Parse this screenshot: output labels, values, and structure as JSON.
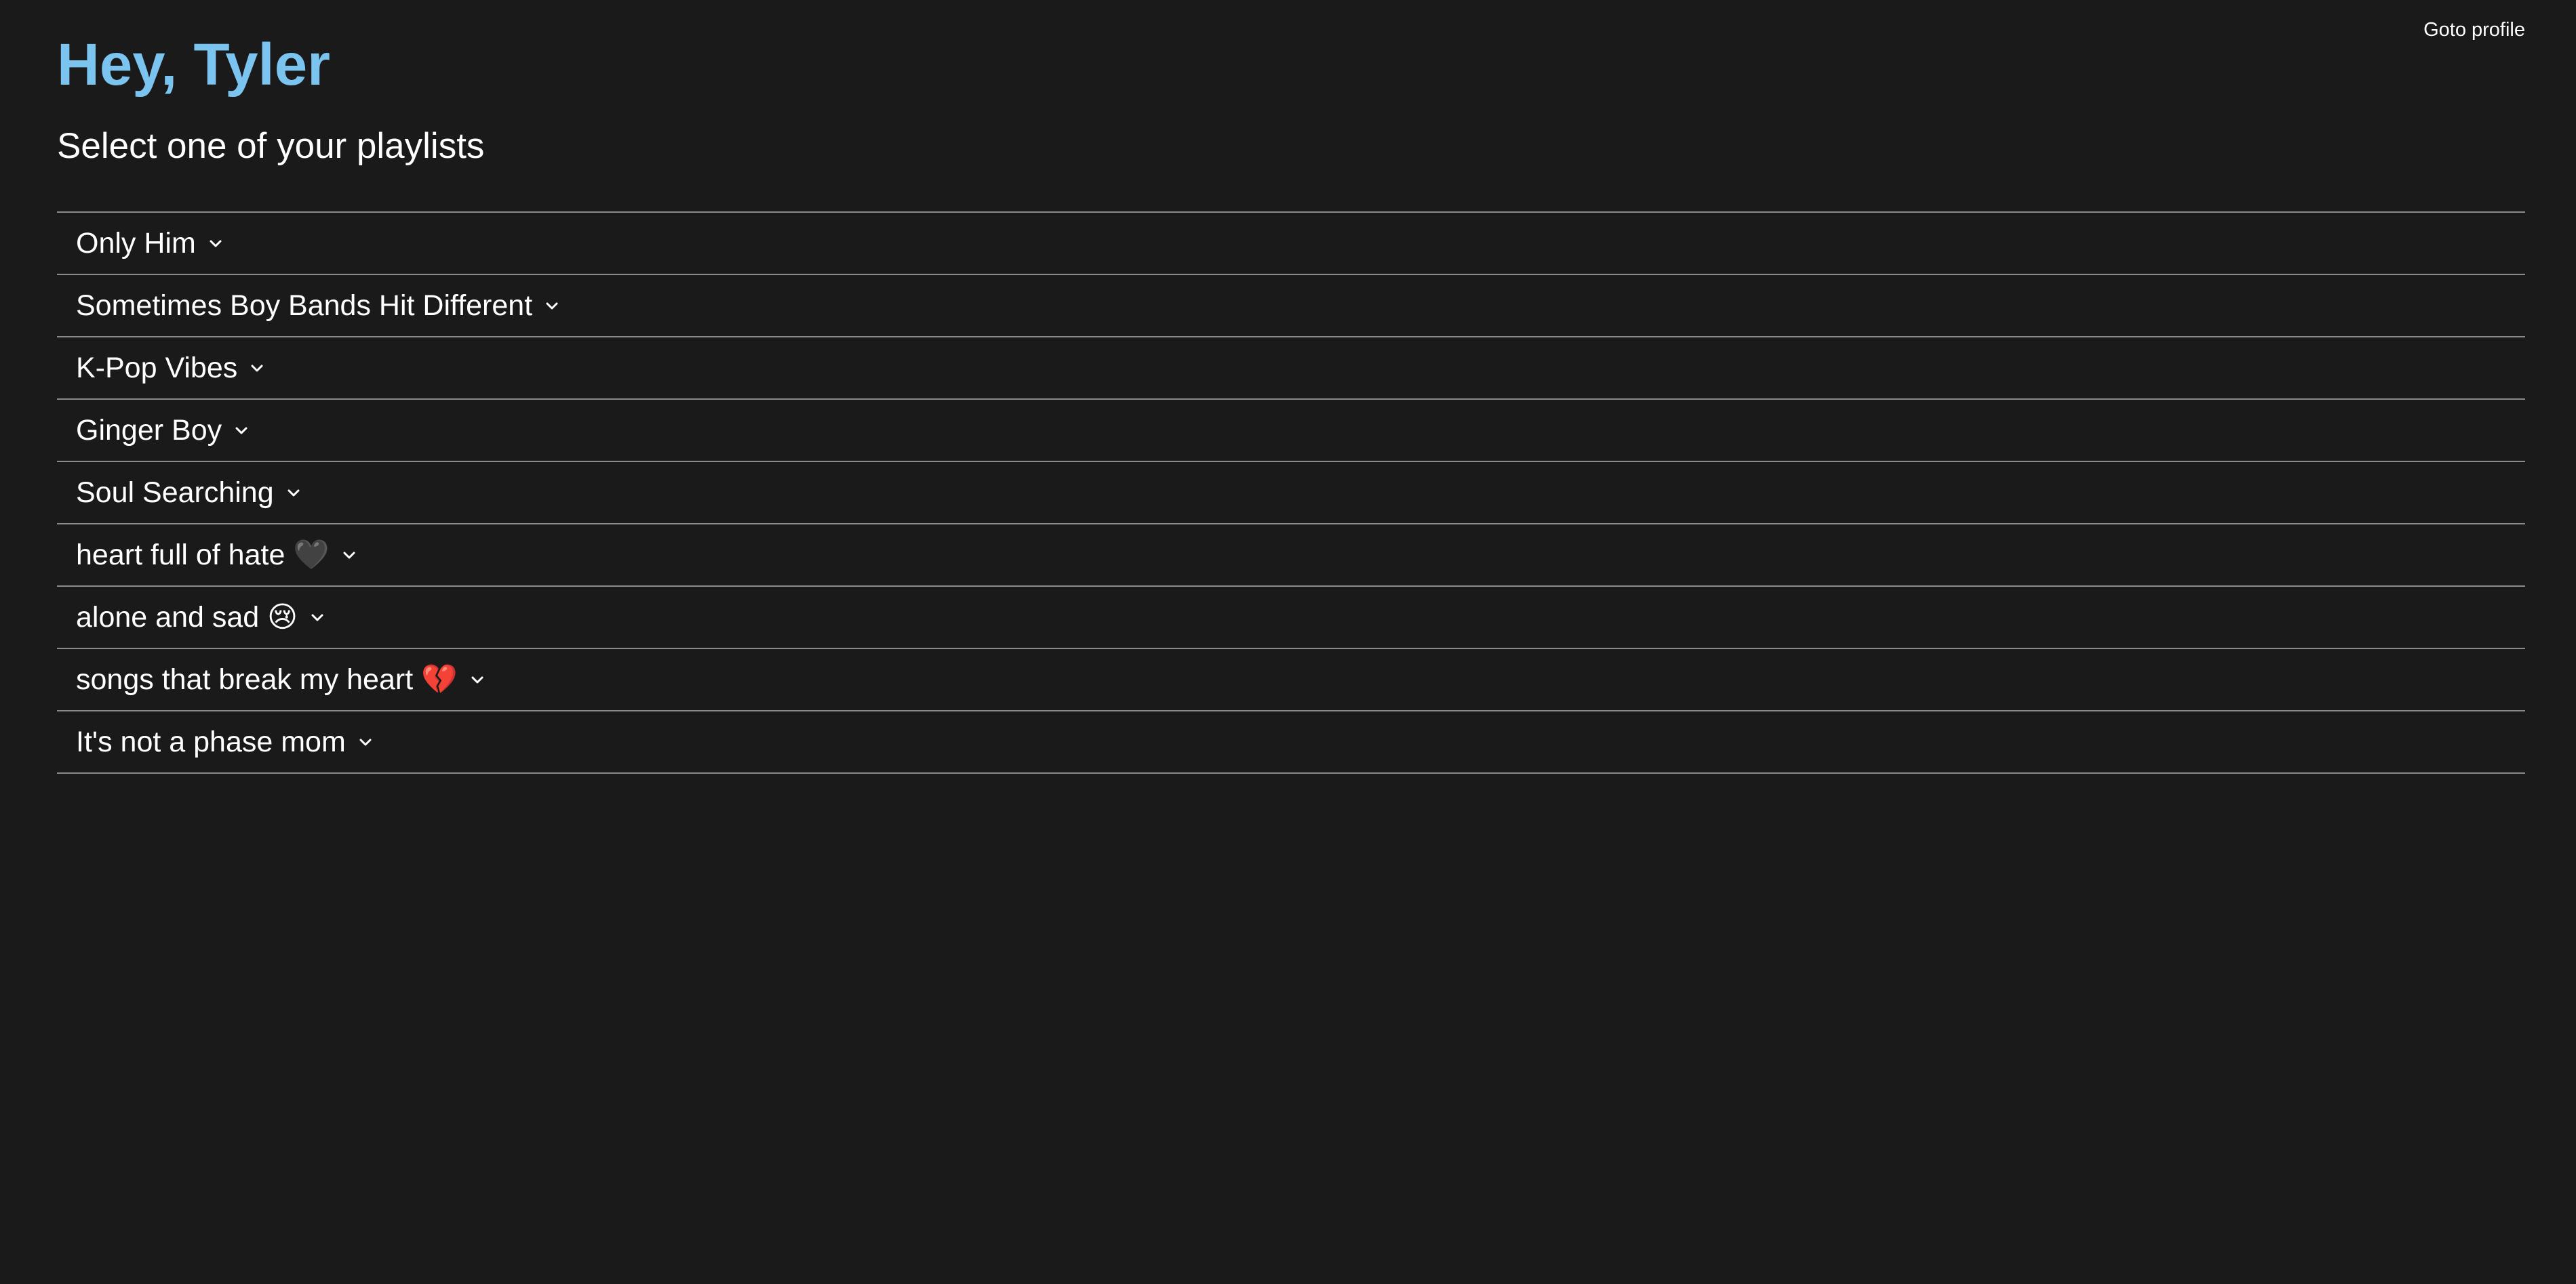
{
  "header": {
    "greeting": "Hey, Tyler",
    "profile_link": "Goto profile"
  },
  "main": {
    "subtitle": "Select one of your playlists",
    "playlists": [
      {
        "label": "Only Him",
        "icon": "chevron-down-icon"
      },
      {
        "label": "Sometimes Boy Bands Hit Different",
        "icon": "chevron-down-icon"
      },
      {
        "label": "K-Pop Vibes",
        "icon": "chevron-down-icon"
      },
      {
        "label": "Ginger Boy",
        "icon": "chevron-down-icon"
      },
      {
        "label": "Soul Searching",
        "icon": "chevron-down-icon"
      },
      {
        "label": "heart full of hate 🖤",
        "icon": "chevron-down-icon"
      },
      {
        "label": "alone and sad 😢",
        "icon": "chevron-down-icon"
      },
      {
        "label": "songs that break my heart 💔",
        "icon": "chevron-down-icon"
      },
      {
        "label": "It's not a phase mom",
        "icon": "chevron-down-icon"
      }
    ]
  },
  "colors": {
    "background": "#1a1a1a",
    "accent": "#7cc4f0",
    "divider": "#8a8a8a",
    "text": "#ffffff"
  }
}
